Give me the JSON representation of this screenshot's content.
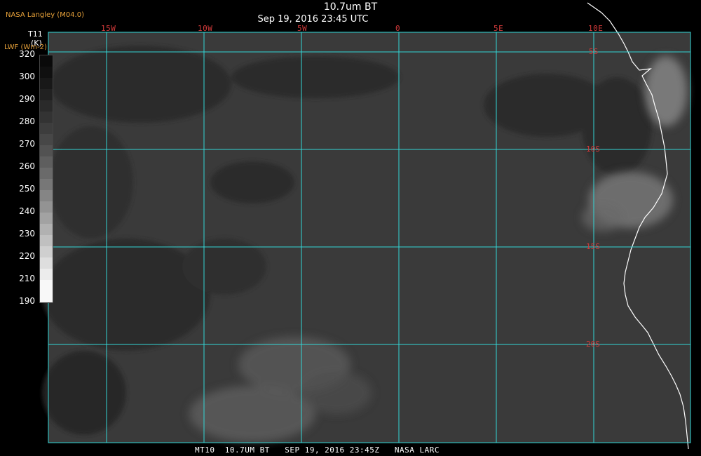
{
  "header": {
    "org": "NASA Langley (M04.0)",
    "title": "10.7um BT",
    "subtitle": "Sep 19, 2016 23:45 UTC"
  },
  "map": {
    "lon_labels": [
      "15W",
      "10W",
      "5W",
      "0",
      "5E",
      "10E"
    ],
    "lat_labels": [
      "5S",
      "10S",
      "15S",
      "20S"
    ],
    "grid_color": "#33d6d6",
    "label_color": "#d23a3a",
    "coastline_color": "#ffffff"
  },
  "legend": {
    "variable": "T11",
    "unit": "(K)",
    "alt_variable": "LWF (Wm-2)",
    "ticks": [
      "320",
      "300",
      "290",
      "280",
      "270",
      "260",
      "250",
      "240",
      "230",
      "220",
      "210",
      "190"
    ]
  },
  "footer": {
    "text": "MT10  10.7UM BT   SEP 19, 2016 23:45Z   NASA LARC"
  }
}
